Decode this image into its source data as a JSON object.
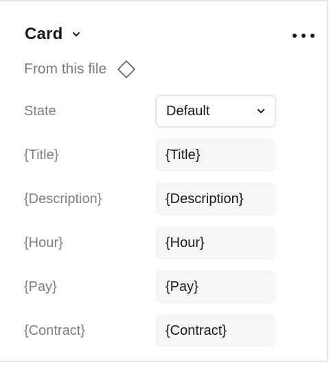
{
  "component": {
    "name": "Card",
    "source_label": "From this file"
  },
  "properties": [
    {
      "label": "State",
      "value": "Default",
      "type": "select"
    },
    {
      "label": "{Title}",
      "value": "{Title}",
      "type": "text"
    },
    {
      "label": "{Description}",
      "value": "{Description}",
      "type": "text"
    },
    {
      "label": "{Hour}",
      "value": "{Hour}",
      "type": "text"
    },
    {
      "label": "{Pay}",
      "value": "{Pay}",
      "type": "text"
    },
    {
      "label": "{Contract}",
      "value": "{Contract}",
      "type": "text"
    }
  ],
  "icons": {
    "title_dropdown": "chevron-down-icon",
    "more": "more-horizontal-icon",
    "component": "diamond-component-icon",
    "select_dropdown": "chevron-down-icon"
  },
  "colors": {
    "text_primary": "#1a1a1a",
    "text_muted": "#7f7f7f",
    "field_bg": "#f5f5f5",
    "border": "#e5e5e5"
  }
}
